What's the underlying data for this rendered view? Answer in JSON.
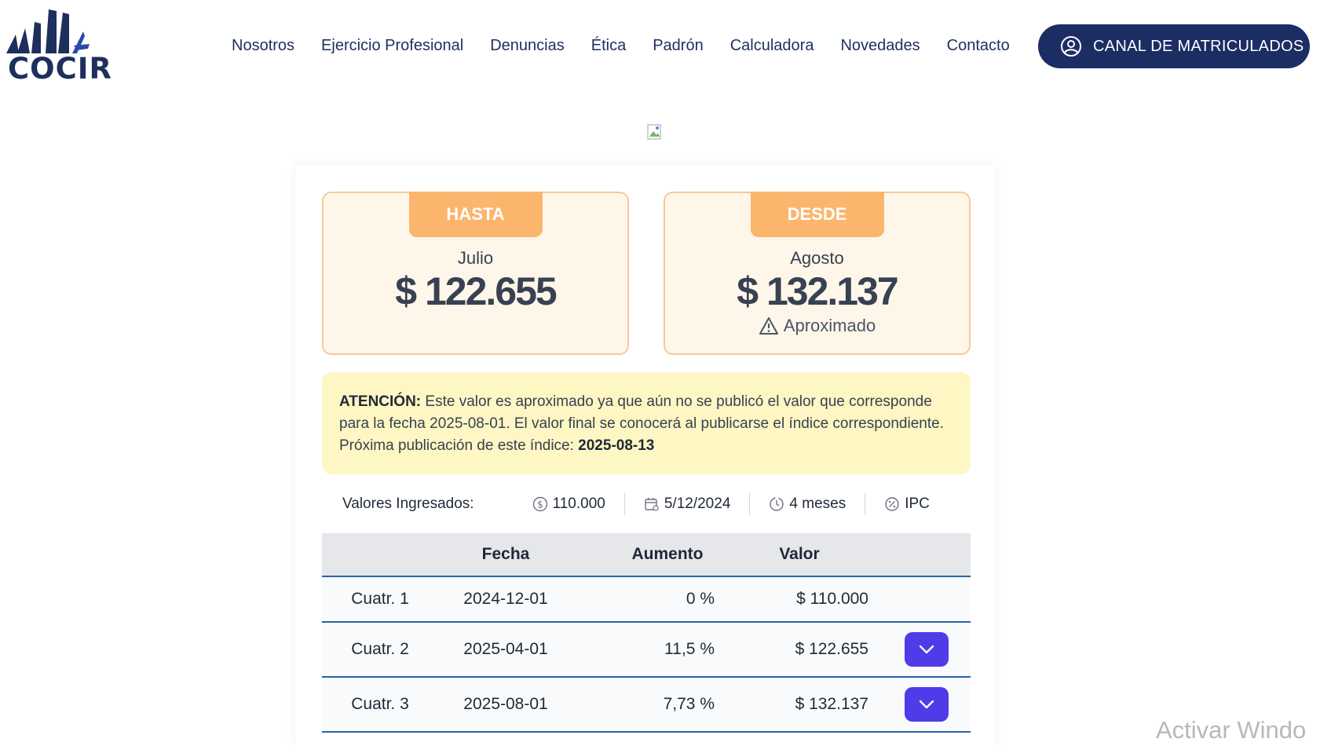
{
  "logo": {
    "text": "COCIR"
  },
  "nav": {
    "items": [
      "Nosotros",
      "Ejercicio Profesional",
      "Denuncias",
      "Ética",
      "Padrón",
      "Calculadora",
      "Novedades",
      "Contacto"
    ],
    "cta_label": "CANAL DE MATRICULADOS"
  },
  "cards": {
    "left": {
      "tag": "HASTA",
      "month": "Julio",
      "amount": "$ 122.655"
    },
    "right": {
      "tag": "DESDE",
      "month": "Agosto",
      "amount": "$ 132.137",
      "note": "Aproximado"
    }
  },
  "alert": {
    "strong": "ATENCIÓN:",
    "text": "Este valor es aproximado ya que aún no se publicó el valor que corresponde para la fecha 2025-08-01. El valor final se conocerá al publicarse el índice correspondiente. Próxima publicación de este índice:",
    "date": "2025-08-13"
  },
  "inputs": {
    "label": "Valores Ingresados:",
    "amount": "110.000",
    "date": "5/12/2024",
    "period": "4 meses",
    "index": "IPC"
  },
  "table": {
    "headers": [
      "",
      "Fecha",
      "Aumento",
      "Valor",
      ""
    ],
    "rows": [
      {
        "label": "Cuatr. 1",
        "fecha": "2024-12-01",
        "aumento": "0 %",
        "valor": "$ 110.000",
        "expandable": false
      },
      {
        "label": "Cuatr. 2",
        "fecha": "2025-04-01",
        "aumento": "11,5 %",
        "valor": "$ 122.655",
        "expandable": true
      },
      {
        "label": "Cuatr. 3",
        "fecha": "2025-08-01",
        "aumento": "7,73 %",
        "valor": "$ 132.137",
        "expandable": true
      }
    ]
  },
  "watermark": "Activar Windo",
  "colors": {
    "navy": "#1b2d63",
    "orange": "#fbb56d",
    "purple": "#4f3be8",
    "yellow": "#fef6c3"
  }
}
